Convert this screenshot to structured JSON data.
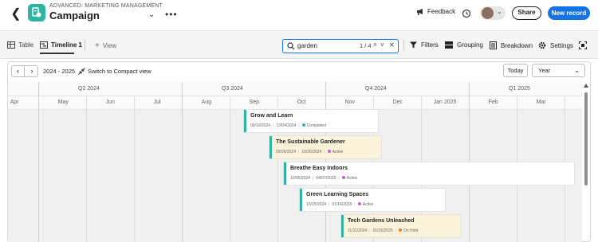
{
  "header": {
    "subtitle": "ADVANCED: MARKETING MANAGEMENT",
    "title": "Campaign",
    "feedback_label": "Feedback",
    "share_label": "Share",
    "new_record_label": "New record",
    "more_label": "•••"
  },
  "toolbar": {
    "tabs": [
      {
        "label": "Table",
        "icon": "table-icon"
      },
      {
        "label": "Timeline 1",
        "icon": "timeline-icon",
        "active": true
      }
    ],
    "add_view_label": "View",
    "search": {
      "value": "garden",
      "count": "1 / 4"
    },
    "filters_label": "Filters",
    "grouping_label": "Grouping",
    "breakdown_label": "Breakdown",
    "settings_label": "Settings"
  },
  "timeline": {
    "range": "2024 - 2025",
    "compact_label": "Switch to Compact view",
    "today_label": "Today",
    "scale": "Year",
    "quarters": [
      "Q2 2024",
      "Q3 2024",
      "Q4 2024",
      "Q1 2025"
    ],
    "months": [
      "Apr",
      "May",
      "Jun",
      "Jul",
      "Aug",
      "Sep",
      "Oct",
      "Nov",
      "Dec",
      "Jan 2025",
      "Feb",
      "Mar"
    ],
    "records": [
      {
        "name": "Grow and Learn",
        "start": "09/10/2024",
        "end": "12/04/2024",
        "status": "Completed",
        "status_color": "#2fb3a3",
        "highlight": false
      },
      {
        "name": "The Sustainable Gardener",
        "start": "09/26/2024",
        "end": "10/26/2024",
        "status": "Active",
        "status_color": "#c05fd6",
        "highlight": true
      },
      {
        "name": "Breathe Easy Indoors",
        "start": "10/05/2024",
        "end": "04/07/2025",
        "status": "Active",
        "status_color": "#c05fd6",
        "highlight": false
      },
      {
        "name": "Green Learning Spaces",
        "start": "10/15/2024",
        "end": "01/16/2025",
        "status": "Active",
        "status_color": "#c05fd6",
        "highlight": false
      },
      {
        "name": "Tech Gardens Unleashed",
        "start": "11/11/2024",
        "end": "01/26/2025",
        "status": "On Hold",
        "status_color": "#e07b39",
        "highlight": true
      }
    ]
  }
}
